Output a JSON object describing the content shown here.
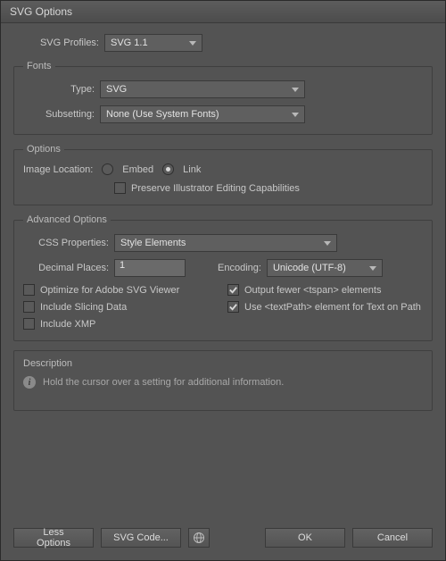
{
  "title": "SVG Options",
  "svgProfiles": {
    "label": "SVG Profiles:",
    "value": "SVG 1.1"
  },
  "fonts": {
    "legend": "Fonts",
    "type": {
      "label": "Type:",
      "value": "SVG"
    },
    "subsetting": {
      "label": "Subsetting:",
      "value": "None (Use System Fonts)"
    }
  },
  "options": {
    "legend": "Options",
    "imageLocation": {
      "label": "Image Location:",
      "embed": "Embed",
      "link": "Link"
    },
    "preserve": "Preserve Illustrator Editing Capabilities"
  },
  "advanced": {
    "legend": "Advanced Options",
    "css": {
      "label": "CSS Properties:",
      "value": "Style Elements"
    },
    "decimal": {
      "label": "Decimal Places:",
      "value": "1"
    },
    "encoding": {
      "label": "Encoding:",
      "value": "Unicode (UTF-8)"
    },
    "optimize": "Optimize for Adobe SVG Viewer",
    "outputTspan": "Output fewer <tspan> elements",
    "slicing": "Include Slicing Data",
    "textPath": "Use <textPath> element for Text on Path",
    "xmp": "Include XMP"
  },
  "description": {
    "legend": "Description",
    "text": "Hold the cursor over a setting for additional information."
  },
  "buttons": {
    "lessOptions": "Less Options",
    "svgCode": "SVG Code...",
    "ok": "OK",
    "cancel": "Cancel"
  }
}
